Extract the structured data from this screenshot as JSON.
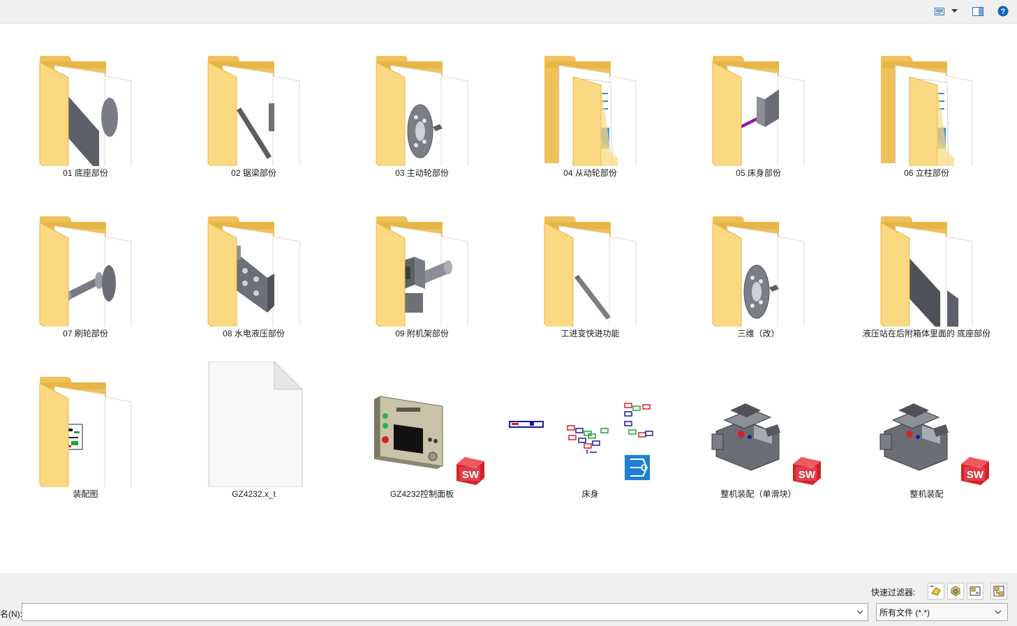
{
  "toolbar": {
    "view_icon": "view-thumbnails-icon",
    "dropdown_icon": "chevron-down-icon",
    "preview_icon": "preview-pane-icon",
    "help_icon": "help-icon",
    "help_glyph": "?",
    "help_color": "#1565c0"
  },
  "items": [
    {
      "label": "01 底座部份",
      "kind": "folder",
      "preview": "plate-disc"
    },
    {
      "label": "02 锯梁部份",
      "kind": "folder",
      "preview": "beam"
    },
    {
      "label": "03 主动轮部份",
      "kind": "folder",
      "preview": "wheel"
    },
    {
      "label": "04 从动轮部份",
      "kind": "folder",
      "preview": "documents"
    },
    {
      "label": "05 床身部份",
      "kind": "folder",
      "preview": "purple-rod"
    },
    {
      "label": "06 立柱部份",
      "kind": "folder",
      "preview": "documents"
    },
    {
      "label": "07 刷轮部份",
      "kind": "folder",
      "preview": "shaft"
    },
    {
      "label": "08 水电液压部份",
      "kind": "folder",
      "preview": "block"
    },
    {
      "label": "09 附机架部份",
      "kind": "folder",
      "preview": "mount"
    },
    {
      "label": "工进变快进功能",
      "kind": "folder",
      "preview": "rail"
    },
    {
      "label": "三维（改）",
      "kind": "folder",
      "preview": "wheel"
    },
    {
      "label": "液压站在后附箱体里面的 底座部份",
      "kind": "folder",
      "preview": "plates"
    },
    {
      "label": "装配图",
      "kind": "folder",
      "preview": "drawing"
    },
    {
      "label": "GZ4232.x_t",
      "kind": "blank-file",
      "preview": "none"
    },
    {
      "label": "GZ4232控制面板",
      "kind": "sw-part",
      "preview": "panel"
    },
    {
      "label": "床身",
      "kind": "dwg",
      "preview": "schematic"
    },
    {
      "label": "整机装配（单滑块）",
      "kind": "sw-assembly",
      "preview": "machine"
    },
    {
      "label": "整机装配",
      "kind": "sw-assembly",
      "preview": "machine"
    }
  ],
  "sw_badge": {
    "text": "SW",
    "color": "#d6202a"
  },
  "folder_colors": {
    "back": "#f0c15a",
    "front": "#fbd982",
    "edge": "#e8b547"
  },
  "bottom": {
    "filter_label": "快速过滤器:",
    "filter_buttons": [
      {
        "icon": "filter-parts-icon"
      },
      {
        "icon": "filter-assemblies-icon"
      },
      {
        "icon": "filter-drawings-icon"
      },
      {
        "icon": "filter-top-level-icon"
      }
    ],
    "filename_label": "名(N):",
    "filename_value": "",
    "filetype_value": "所有文件 (*.*)"
  }
}
